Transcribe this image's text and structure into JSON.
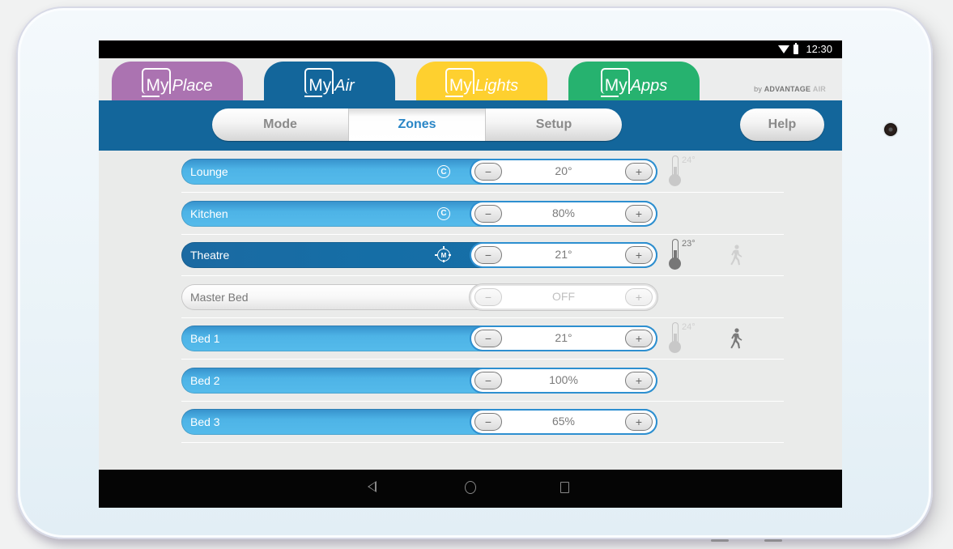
{
  "status_bar": {
    "time": "12:30",
    "icons": [
      "wifi-icon",
      "battery-icon"
    ]
  },
  "app_tabs": [
    {
      "prefix": "My",
      "name": "Place",
      "color": "#ab73b1",
      "active": false
    },
    {
      "prefix": "My",
      "name": "Air",
      "color": "#13669b",
      "active": true
    },
    {
      "prefix": "My",
      "name": "Lights",
      "color": "#fed02f",
      "active": false
    },
    {
      "prefix": "My",
      "name": "Apps",
      "color": "#26b26f",
      "active": false
    }
  ],
  "brand": {
    "by": "by",
    "company": "ADVANTAGE",
    "suffix": "AIR"
  },
  "nav": {
    "segments": [
      {
        "label": "Mode",
        "active": false
      },
      {
        "label": "Zones",
        "active": true
      },
      {
        "label": "Setup",
        "active": false
      }
    ],
    "help_label": "Help",
    "accent": "#2a86c6"
  },
  "zones": [
    {
      "name": "Lounge",
      "mode_icon": "C",
      "mode_icon_name": "constant-zone-icon",
      "value": "20°",
      "state": "on",
      "temp": "24°",
      "temp_active": false,
      "motion": null
    },
    {
      "name": "Kitchen",
      "mode_icon": "C",
      "mode_icon_name": "constant-zone-icon",
      "value": "80%",
      "state": "on",
      "temp": null,
      "temp_active": false,
      "motion": null
    },
    {
      "name": "Theatre",
      "mode_icon": "M",
      "mode_icon_name": "myzone-target-icon",
      "value": "21°",
      "state": "selected",
      "temp": "23°",
      "temp_active": true,
      "motion": "inactive"
    },
    {
      "name": "Master Bed",
      "mode_icon": null,
      "mode_icon_name": null,
      "value": "OFF",
      "state": "off",
      "temp": null,
      "temp_active": false,
      "motion": null
    },
    {
      "name": "Bed 1",
      "mode_icon": null,
      "mode_icon_name": null,
      "value": "21°",
      "state": "on",
      "temp": "24°",
      "temp_active": false,
      "motion": "active"
    },
    {
      "name": "Bed 2",
      "mode_icon": null,
      "mode_icon_name": null,
      "value": "100%",
      "state": "on",
      "temp": null,
      "temp_active": false,
      "motion": null
    },
    {
      "name": "Bed 3",
      "mode_icon": null,
      "mode_icon_name": null,
      "value": "65%",
      "state": "on",
      "temp": null,
      "temp_active": false,
      "motion": null
    }
  ],
  "stepper": {
    "minus_symbol": "−",
    "plus_symbol": "+"
  },
  "system_nav": [
    "back",
    "home",
    "recents"
  ]
}
